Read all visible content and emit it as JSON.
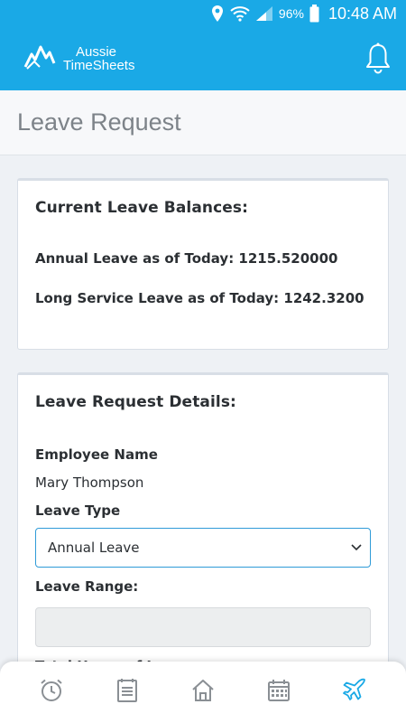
{
  "status_bar": {
    "battery": "96%",
    "time": "10:48 AM"
  },
  "header": {
    "logo_line1": "Aussie",
    "logo_line2": "TimeSheets"
  },
  "page": {
    "title": "Leave Request"
  },
  "balances": {
    "heading": "Current Leave Balances:",
    "annual_line": "Annual Leave as of Today: 1215.520000",
    "long_service_line": "Long Service Leave as of Today: 1242.3200"
  },
  "details": {
    "heading": "Leave Request Details:",
    "employee_label": "Employee Name",
    "employee_value": "Mary Thompson",
    "leave_type_label": "Leave Type",
    "leave_type_value": "Annual Leave",
    "leave_range_label": "Leave Range:",
    "leave_range_value": "",
    "total_hours_label": "Total Hours of Leave"
  },
  "nav": {
    "items": [
      {
        "icon": "alarm-clock-icon"
      },
      {
        "icon": "timesheet-icon"
      },
      {
        "icon": "home-icon"
      },
      {
        "icon": "calendar-icon"
      },
      {
        "icon": "airplane-icon",
        "active": true
      }
    ],
    "active_color": "#1aa9e6",
    "inactive_color": "#8a8f94"
  },
  "colors": {
    "brand": "#1aa9e6",
    "accent_border": "#2f9bd8"
  }
}
